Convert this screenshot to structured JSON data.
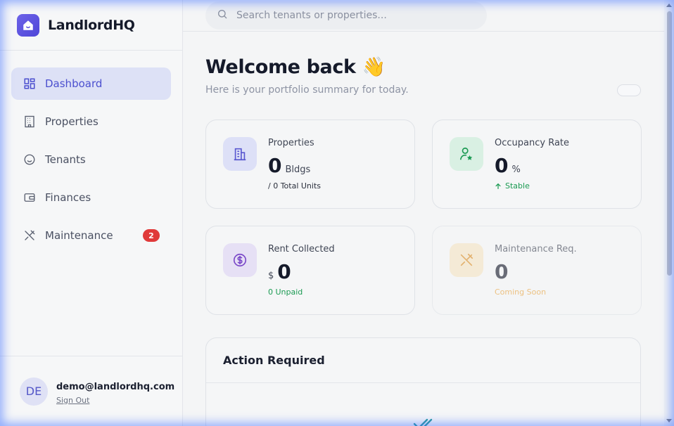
{
  "brand": {
    "name": "LandlordHQ",
    "logo_icon": "home-icon",
    "accent": "#5b52e0"
  },
  "search": {
    "placeholder": "Search tenants or properties..."
  },
  "sidebar": {
    "items": [
      {
        "label": "Dashboard",
        "icon": "grid-icon",
        "active": true
      },
      {
        "label": "Properties",
        "icon": "building-icon"
      },
      {
        "label": "Tenants",
        "icon": "smile-icon"
      },
      {
        "label": "Finances",
        "icon": "wallet-icon"
      },
      {
        "label": "Maintenance",
        "icon": "tools-icon",
        "badge": "2"
      }
    ]
  },
  "user": {
    "initials": "DE",
    "email": "demo@landlordhq.com",
    "signout": "Sign Out"
  },
  "header": {
    "welcome": "Welcome back 👋",
    "subtitle": "Here is your portfolio summary for today."
  },
  "cards": {
    "properties": {
      "title": "Properties",
      "value": "0",
      "unit": "Bldgs",
      "note": "/ 0 Total Units",
      "icon": "building-icon"
    },
    "occupancy": {
      "title": "Occupancy Rate",
      "value": "0",
      "unit": "%",
      "note": "Stable",
      "note_icon": "arrow-up-icon",
      "icon": "user-star-icon",
      "note_color": "#1a9a52"
    },
    "rent": {
      "title": "Rent Collected",
      "prefix": "$",
      "value": "0",
      "note": "0 Unpaid",
      "icon": "dollar-circle-icon",
      "note_color": "#1a9a52"
    },
    "maintenance": {
      "title": "Maintenance Req.",
      "value": "0",
      "note": "Coming Soon",
      "icon": "tools-icon",
      "note_color": "#e8a23a"
    }
  },
  "action": {
    "title": "Action Required"
  },
  "colors": {
    "active_bg": "#dde1f6",
    "active_fg": "#4b4fcf",
    "badge": "#e03a3a"
  }
}
